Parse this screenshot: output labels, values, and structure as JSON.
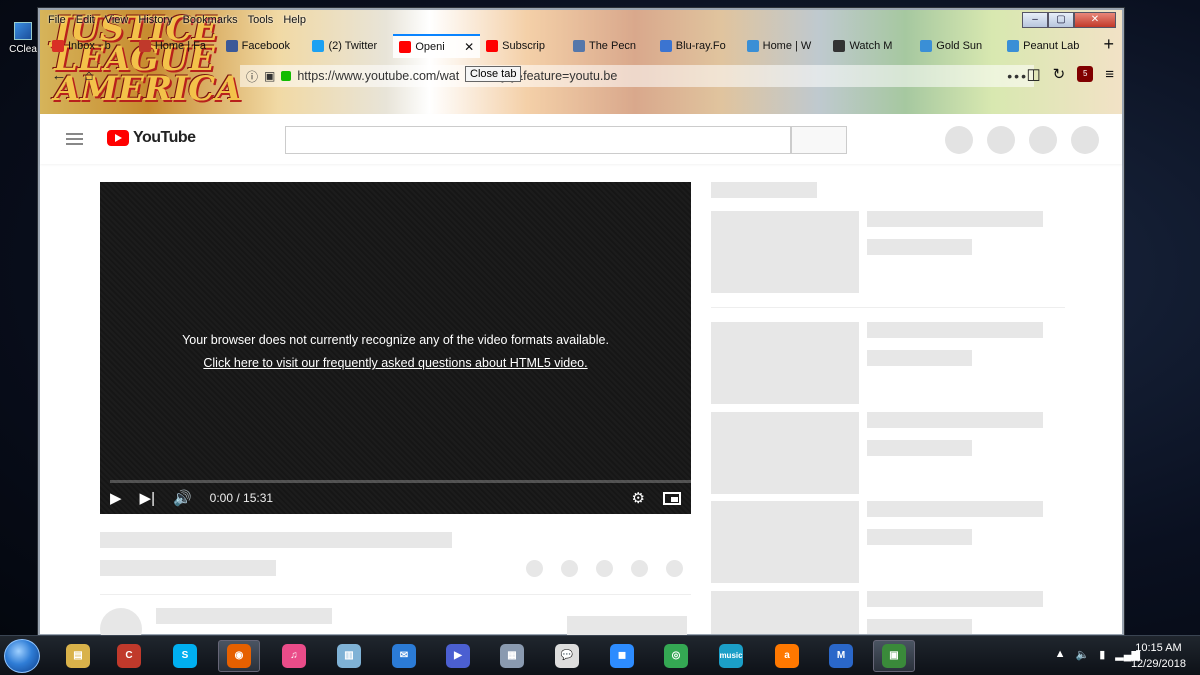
{
  "desktop": {
    "icon_label": "CClea"
  },
  "browser": {
    "menu": [
      "File",
      "Edit",
      "View",
      "History",
      "Bookmarks",
      "Tools",
      "Help"
    ],
    "window_controls": [
      "–",
      "▢",
      "✕"
    ],
    "tabs": [
      {
        "label": "Inbox - b",
        "favicon": "mail-icon",
        "color": "#d93025"
      },
      {
        "label": "Home | Fa",
        "favicon": "heart-icon",
        "color": "#c0392b"
      },
      {
        "label": "Facebook",
        "favicon": "facebook-icon",
        "color": "#3b5998"
      },
      {
        "label": "(2) Twitter",
        "favicon": "twitter-icon",
        "color": "#1da1f2"
      },
      {
        "label": "Openi",
        "favicon": "youtube-icon",
        "color": "#ff0000",
        "active": true
      },
      {
        "label": "Subscrip",
        "favicon": "youtube-icon",
        "color": "#ff0000"
      },
      {
        "label": "The Pecn",
        "favicon": "search-icon",
        "color": "#5577aa"
      },
      {
        "label": "Blu-ray.Fo",
        "favicon": "bluray-icon",
        "color": "#3b74d1"
      },
      {
        "label": "Home | W",
        "favicon": "diamond-icon",
        "color": "#3a8fd6"
      },
      {
        "label": "Watch M",
        "favicon": "mask-icon",
        "color": "#333333"
      },
      {
        "label": "Gold Sun",
        "favicon": "diamond-icon",
        "color": "#3a8fd6"
      },
      {
        "label": "Peanut Lab",
        "favicon": "diamond-icon",
        "color": "#3a8fd6"
      }
    ],
    "new_tab": "+",
    "tooltip": "Close tab",
    "url": "https://www.youtube.com/wat",
    "url_tail": "Tu-ilcQQ&feature=youtu.be",
    "page_actions": "•••",
    "badge_count": "5"
  },
  "youtube": {
    "logo_text": "YouTube",
    "player": {
      "message": "Your browser does not currently recognize any of the video formats available.",
      "link": "Click here to visit our frequently asked questions about HTML5 video.",
      "time": "0:00 / 15:31",
      "progress": 0
    }
  },
  "taskbar": {
    "apps": [
      {
        "name": "explorer-icon",
        "color": "#d9b24a",
        "glyph": "▤"
      },
      {
        "name": "ccleaner-icon",
        "color": "#c0392b",
        "glyph": "C"
      },
      {
        "name": "skype-icon",
        "color": "#00aff0",
        "glyph": "S"
      },
      {
        "name": "firefox-icon",
        "color": "#e66000",
        "glyph": "◉",
        "open": true
      },
      {
        "name": "itunes-icon",
        "color": "#ea4c89",
        "glyph": "♫"
      },
      {
        "name": "notepad-icon",
        "color": "#7fb2d6",
        "glyph": "▥"
      },
      {
        "name": "thunderbird-icon",
        "color": "#2b7bd6",
        "glyph": "✉"
      },
      {
        "name": "media-player-icon",
        "color": "#4b5fd1",
        "glyph": "▶"
      },
      {
        "name": "calculator-icon",
        "color": "#8a9ab0",
        "glyph": "▦"
      },
      {
        "name": "messages-icon",
        "color": "#dddddd",
        "glyph": "💬"
      },
      {
        "name": "zoom-icon",
        "color": "#2d8cff",
        "glyph": "◼"
      },
      {
        "name": "chrome-icon",
        "color": "#34a853",
        "glyph": "◎"
      },
      {
        "name": "amazon-music-icon",
        "color": "#1b9fc8",
        "glyph": "music"
      },
      {
        "name": "avast-icon",
        "color": "#ff7800",
        "glyph": "a"
      },
      {
        "name": "malwarebytes-icon",
        "color": "#2a67c9",
        "glyph": "M"
      },
      {
        "name": "task-manager-icon",
        "color": "#3a8a3a",
        "glyph": "▣",
        "open": true
      }
    ],
    "clock_time": "10:15 AM",
    "clock_date": "12/29/2018"
  }
}
